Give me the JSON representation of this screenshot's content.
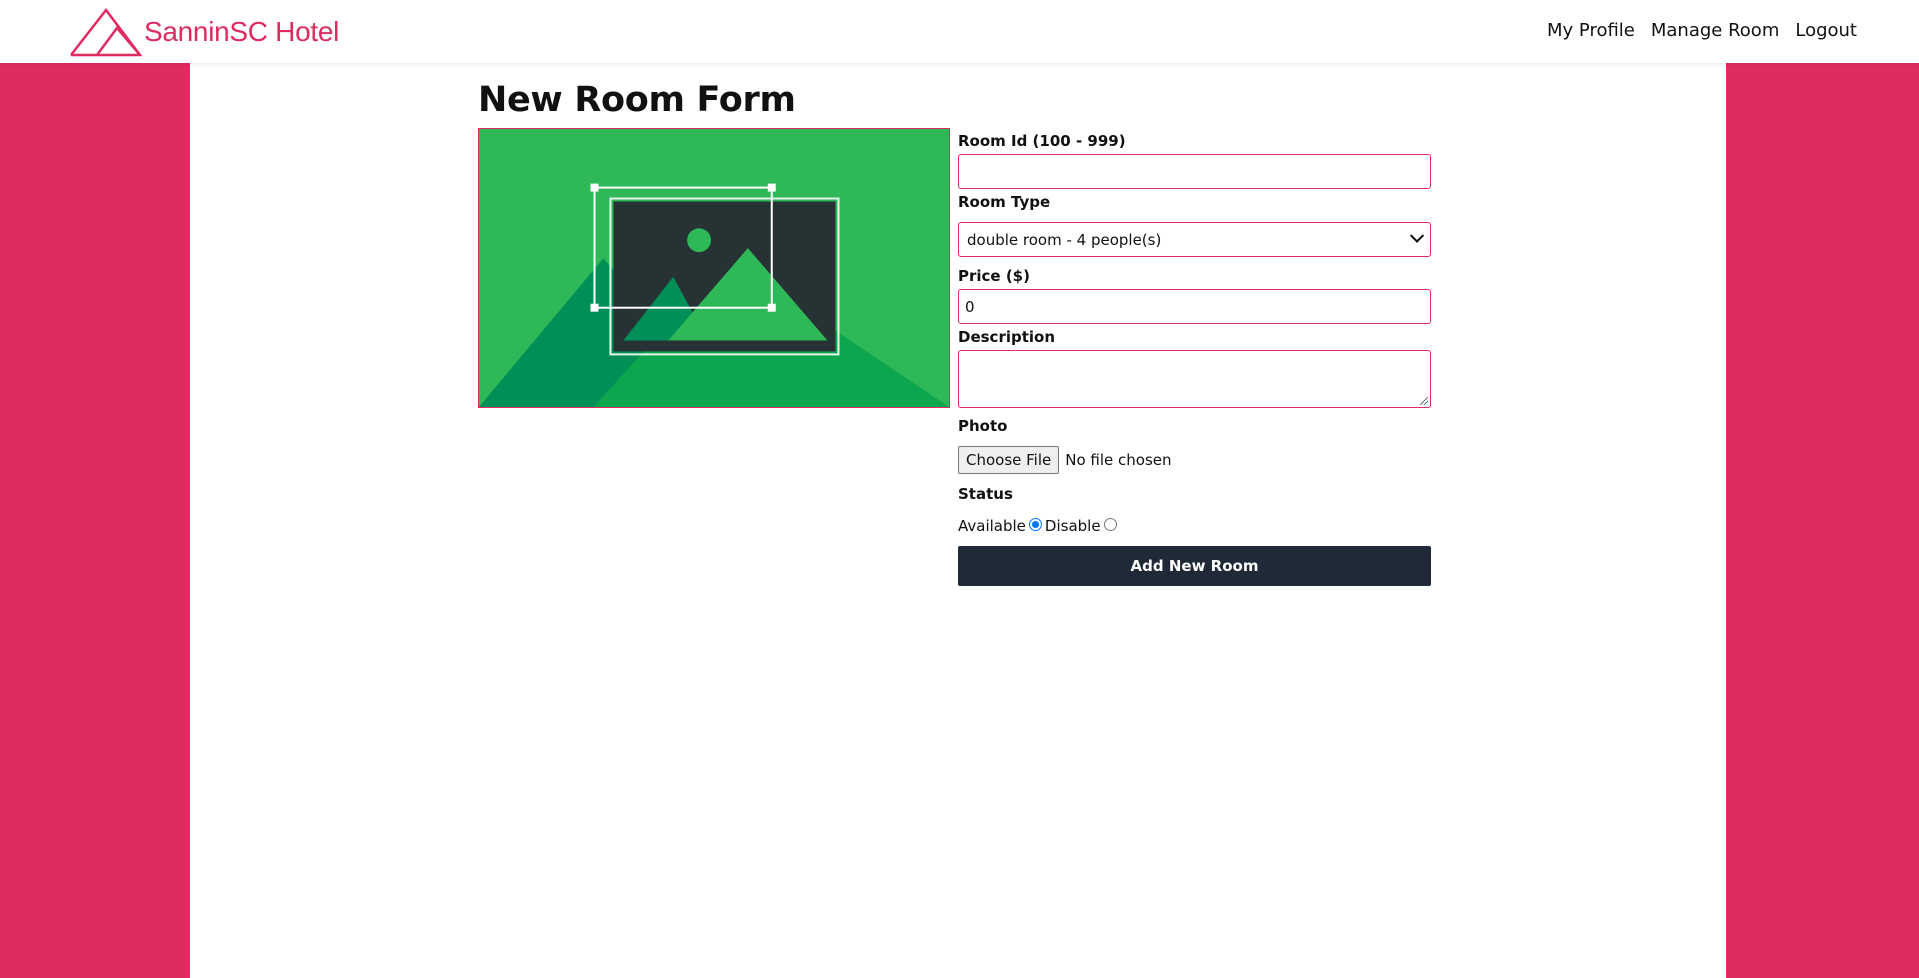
{
  "brand": {
    "name": "SanninSC Hotel"
  },
  "nav": {
    "profile": "My Profile",
    "manage": "Manage Room",
    "logout": "Logout"
  },
  "page": {
    "title": "New Room Form"
  },
  "form": {
    "room_id": {
      "label": "Room Id (100 - 999)",
      "value": ""
    },
    "room_type": {
      "label": "Room Type",
      "selected": "double room - 4 people(s)"
    },
    "price": {
      "label": "Price ($)",
      "value": "0"
    },
    "description": {
      "label": "Description",
      "value": ""
    },
    "photo": {
      "label": "Photo",
      "button": "Choose File",
      "status": "No file chosen"
    },
    "status": {
      "label": "Status",
      "options": [
        "Available",
        "Disable"
      ],
      "selected": "Available"
    },
    "submit": "Add New Room"
  },
  "colors": {
    "accent": "#e02b60",
    "submit_bg": "#1f2937",
    "preview_bg": "#2eb857"
  },
  "icons": {
    "logo": "mountain-logo-icon",
    "preview": "image-placeholder-icon"
  }
}
